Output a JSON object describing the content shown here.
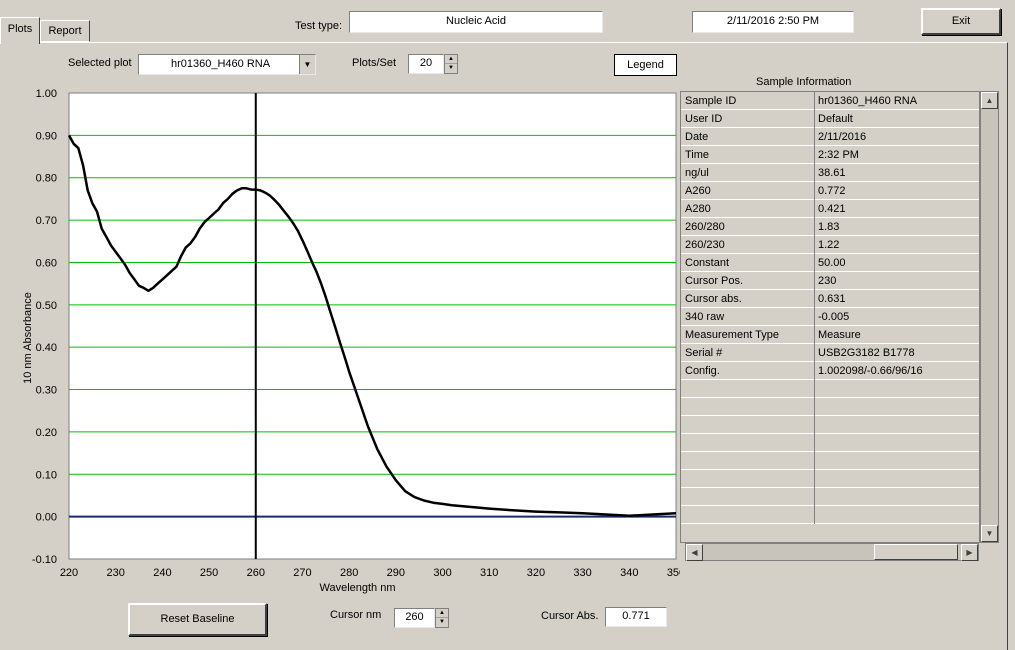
{
  "tabs": [
    {
      "label": "Plots"
    },
    {
      "label": "Report"
    }
  ],
  "header": {
    "test_type_label": "Test type:",
    "test_type_value": "Nucleic Acid",
    "datetime": "2/11/2016  2:50 PM",
    "exit_label": "Exit"
  },
  "controls": {
    "selected_plot_label": "Selected plot",
    "selected_plot_value": "hr01360_H460 RNA",
    "plots_per_set_label": "Plots/Set",
    "plots_per_set_value": "20",
    "legend_label": "Legend",
    "reset_baseline_label": "Reset Baseline",
    "cursor_nm_label": "Cursor nm",
    "cursor_nm_value": "260",
    "cursor_abs_label": "Cursor Abs.",
    "cursor_abs_value": "0.771"
  },
  "sample_info": {
    "title": "Sample Information",
    "rows": [
      [
        "Sample ID",
        "hr01360_H460 RNA"
      ],
      [
        "User ID",
        "Default"
      ],
      [
        "Date",
        "2/11/2016"
      ],
      [
        "Time",
        "2:32 PM"
      ],
      [
        "ng/ul",
        " 38.61"
      ],
      [
        "A260",
        " 0.772"
      ],
      [
        "A280",
        " 0.421"
      ],
      [
        "260/280",
        "  1.83"
      ],
      [
        "260/230",
        "  1.22"
      ],
      [
        "Constant",
        " 50.00"
      ],
      [
        "Cursor Pos.",
        " 230"
      ],
      [
        "Cursor abs.",
        " 0.631"
      ],
      [
        "340 raw",
        " -0.005"
      ],
      [
        "Measurement Type",
        "Measure"
      ],
      [
        "Serial #",
        "USB2G3182 B1778"
      ],
      [
        "Config.",
        "1.002098/-0.66/96/16"
      ]
    ],
    "empty_rows": 8
  },
  "chart_data": {
    "type": "line",
    "xlabel": "Wavelength nm",
    "ylabel": "10 nm Absorbance",
    "xlim": [
      220,
      350
    ],
    "ylim": [
      -0.1,
      1.0
    ],
    "x_ticks": [
      "220",
      "230",
      "240",
      "250",
      "260",
      "270",
      "280",
      "290",
      "300",
      "310",
      "320",
      "330",
      "340",
      "350"
    ],
    "y_ticks": [
      "1.00",
      "0.90",
      "0.80",
      "0.70",
      "0.60",
      "0.50",
      "0.40",
      "0.30",
      "0.20",
      "0.10",
      "0.00",
      "-0.10"
    ],
    "grid": true,
    "cursor_x": 260,
    "colors": {
      "series": "#000000",
      "grid": "#00c000",
      "baseline": "#1a2a6c",
      "cursor": "#000000"
    },
    "series": [
      {
        "x": [
          220,
          221,
          222,
          223,
          224,
          225,
          226,
          227,
          228,
          229,
          230,
          231,
          232,
          233,
          234,
          235,
          236,
          237,
          238,
          239,
          240,
          241,
          242,
          243,
          244,
          245,
          246,
          247,
          248,
          249,
          250,
          251,
          252,
          253,
          254,
          255,
          256,
          257,
          258,
          259,
          260,
          261,
          262,
          263,
          264,
          265,
          266,
          267,
          268,
          269,
          270,
          271,
          272,
          273,
          274,
          275,
          276,
          277,
          278,
          279,
          280,
          282,
          284,
          286,
          288,
          290,
          292,
          294,
          296,
          298,
          300,
          302,
          305,
          310,
          315,
          320,
          325,
          330,
          335,
          340,
          345,
          350
        ],
        "y": [
          0.9,
          0.88,
          0.87,
          0.83,
          0.77,
          0.74,
          0.72,
          0.68,
          0.66,
          0.64,
          0.625,
          0.61,
          0.595,
          0.575,
          0.56,
          0.545,
          0.54,
          0.533,
          0.54,
          0.55,
          0.56,
          0.57,
          0.58,
          0.59,
          0.615,
          0.635,
          0.645,
          0.66,
          0.68,
          0.695,
          0.705,
          0.715,
          0.725,
          0.74,
          0.75,
          0.762,
          0.77,
          0.775,
          0.775,
          0.772,
          0.772,
          0.77,
          0.765,
          0.758,
          0.748,
          0.736,
          0.722,
          0.708,
          0.693,
          0.675,
          0.652,
          0.628,
          0.602,
          0.578,
          0.55,
          0.518,
          0.482,
          0.448,
          0.412,
          0.378,
          0.342,
          0.278,
          0.214,
          0.16,
          0.118,
          0.086,
          0.06,
          0.046,
          0.038,
          0.033,
          0.03,
          0.027,
          0.024,
          0.019,
          0.015,
          0.012,
          0.01,
          0.008,
          0.005,
          0.002,
          0.005,
          0.008
        ]
      }
    ]
  }
}
